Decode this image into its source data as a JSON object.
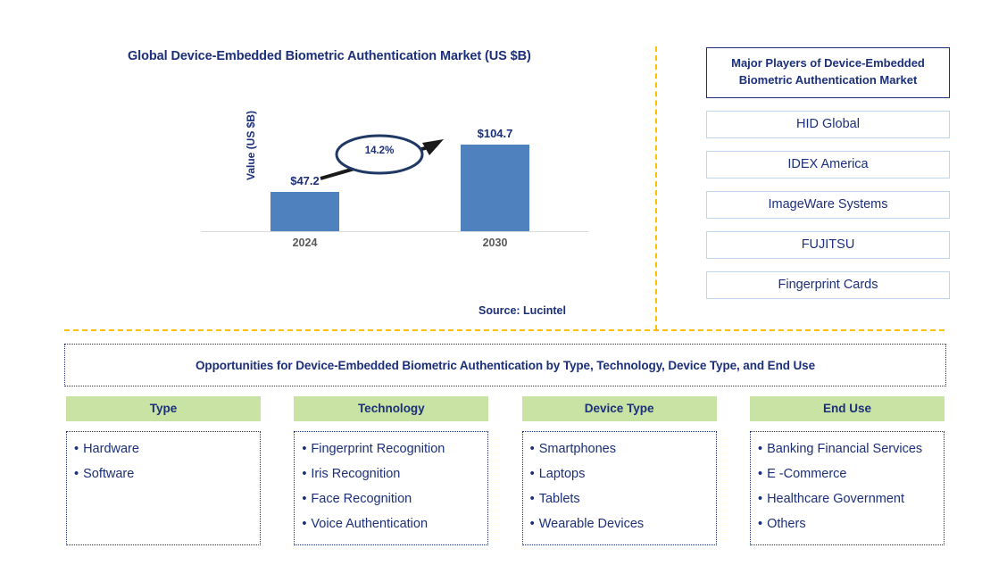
{
  "chart_panel": {
    "title": "Global Device-Embedded Biometric Authentication Market (US $B)",
    "source": "Source: Lucintel"
  },
  "chart_data": {
    "type": "bar",
    "title": "Global Device-Embedded Biometric Authentication Market (US $B)",
    "xlabel": "",
    "ylabel": "Value (US $B)",
    "categories": [
      "2024",
      "2030"
    ],
    "values": [
      47.2,
      104.7
    ],
    "value_labels": [
      "$47.2",
      "$104.7"
    ],
    "ylim": [
      0,
      104.7
    ],
    "grid": false,
    "legend": false,
    "bar_color": "#4e81bd",
    "annotations": [
      {
        "text": "14.2%",
        "kind": "cagr-arrow-ellipse",
        "from": "2024",
        "to": "2030"
      }
    ]
  },
  "players_panel": {
    "header": "Major Players of Device-Embedded Biometric Authentication Market",
    "items": [
      "HID Global",
      "IDEX America",
      "ImageWare Systems",
      "FUJITSU",
      "Fingerprint Cards"
    ]
  },
  "opportunities": {
    "banner": "Opportunities for Device-Embedded Biometric Authentication by Type, Technology, Device Type, and End Use",
    "columns": [
      {
        "header": "Type",
        "items": [
          "Hardware",
          "Software"
        ]
      },
      {
        "header": "Technology",
        "items": [
          "Fingerprint Recognition",
          "Iris Recognition",
          "Face Recognition",
          "Voice Authentication"
        ]
      },
      {
        "header": "Device Type",
        "items": [
          "Smartphones",
          "Laptops",
          "Tablets",
          "Wearable Devices"
        ]
      },
      {
        "header": "End Use",
        "items": [
          "Banking Financial Services",
          "E -Commerce",
          "Healthcare Government",
          "Others"
        ]
      }
    ]
  },
  "colors": {
    "navy": "#1b2f7a",
    "bar_blue": "#4e81bd",
    "divider_gold": "#ffc000",
    "header_green": "#c9e3a4",
    "player_border": "#bdd7ee"
  }
}
